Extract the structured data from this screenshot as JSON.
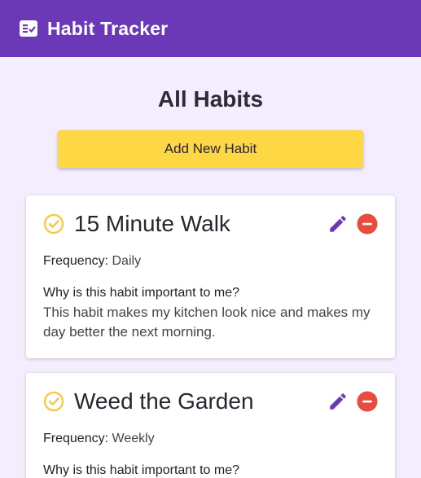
{
  "app": {
    "title": "Habit Tracker",
    "icon": "checklist-icon",
    "header_color": "#6b38b8"
  },
  "page": {
    "title": "All Habits",
    "add_button_label": "Add New Habit",
    "accent": "#fdd744"
  },
  "habits": [
    {
      "name": "15 Minute Walk",
      "frequency_label": "Frequency:",
      "frequency": "Daily",
      "why_label": "Why is this habit important to me?",
      "why": "This habit makes my kitchen look nice and makes my day better the next morning."
    },
    {
      "name": "Weed the Garden",
      "frequency_label": "Frequency:",
      "frequency": "Weekly",
      "why_label": "Why is this habit important to me?",
      "why": ""
    }
  ],
  "icons": {
    "check": "check-circle-icon",
    "edit": "pencil-icon",
    "delete": "remove-circle-icon"
  },
  "colors": {
    "check": "#f7c948",
    "edit": "#6b38b8",
    "delete": "#e74c3c"
  }
}
